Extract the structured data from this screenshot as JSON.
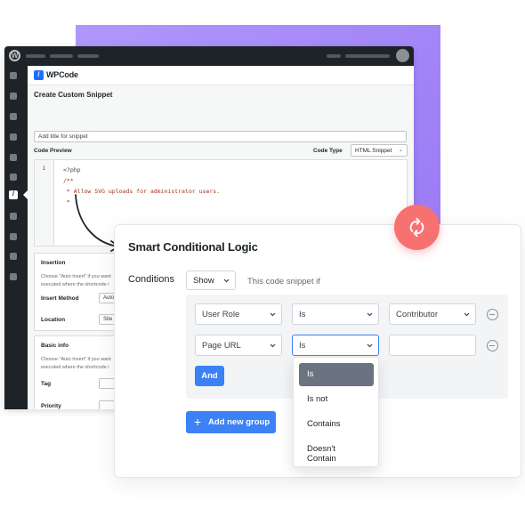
{
  "wp_admin": {
    "brand": "WPCode",
    "page_title": "Create Custom Snippet",
    "title_input_placeholder": "Add title for snippet",
    "code_preview_label": "Code Preview",
    "code_type_label": "Code Type",
    "code_type_value": "HTML Snippet",
    "code": {
      "line_number": "1",
      "lines": [
        "<?php",
        "/**",
        " * Allow SVG uploads for administrator users.",
        " *"
      ]
    },
    "insertion_panel": {
      "title": "Insertion",
      "help": "Choose \"Auto Insert\" if you want",
      "help2": "executed where the shortcode i",
      "insert_method_label": "Insert Method",
      "insert_method_value": "Auto I",
      "location_label": "Location",
      "location_value": "Site wi"
    },
    "basic_info_panel": {
      "title": "Basic info",
      "help": "Choose \"Auto Insert\" if you want",
      "help2": "executed where the shortcode i",
      "tag_label": "Tag",
      "priority_label": "Priority"
    }
  },
  "logic_card": {
    "title": "Smart Conditional Logic",
    "conditions_label": "Conditions",
    "show_select_value": "Show",
    "snippet_if_text": "This code snippet if",
    "rows": [
      {
        "field": "User Role",
        "operator": "Is",
        "value": "Contributor"
      },
      {
        "field": "Page URL",
        "operator": "Is",
        "value": ""
      }
    ],
    "and_button": "And",
    "add_group_button": "Add new group",
    "dropdown_options": [
      "Is",
      "Is not",
      "Contains",
      "Doesn't Contain"
    ],
    "dropdown_selected": "Is"
  },
  "colors": {
    "accent": "#3b82f6",
    "purple": "#a78bfa",
    "badge": "#f87171",
    "wp_dark": "#1d2327"
  }
}
